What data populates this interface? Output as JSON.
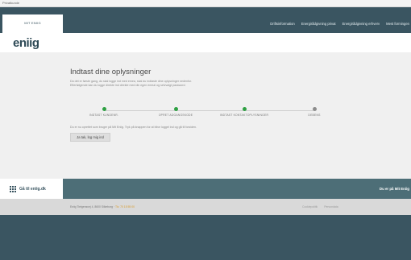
{
  "browser": {
    "tab_title": "Privatkunde"
  },
  "header": {
    "active_tab": "MIT ENIIG",
    "nav": [
      "Driftsinformation",
      "Energirådgivning privat",
      "Energirådgivning erhverv",
      "Mest formingen"
    ]
  },
  "brand": {
    "logo": "eniig"
  },
  "main": {
    "title": "Indtast dine oplysninger",
    "intro_lines": [
      "Da det er første gang, du skal logge ind med emea, skal du indtaste dine oplysninger nedenfor.",
      "Efterfølgende kan du logge direkte ind direkte med din egen emeal og selvvalgt password."
    ],
    "steps": [
      {
        "label": "INDTAST KUNDENR.",
        "status": "done"
      },
      {
        "label": "OPRET ADGANGSKODE",
        "status": "done"
      },
      {
        "label": "INDTAST KONTAKTOPLYSNINGER",
        "status": "done"
      },
      {
        "label": "DEBENS",
        "status": "pending"
      }
    ],
    "notice": "Du er nu oprettet som bruger på Mit Eniig. Tryk på knappen for at blive logget ind og gå til forsiden.",
    "login_button": "Ja tak, log mig ind"
  },
  "bar": {
    "left_link": "Gå til eniig.dk",
    "right_text": "Du er på Mit Eniig"
  },
  "footer": {
    "address": "Eniig Tietgensvej 4, 8600 Silkeborg ·",
    "address_link": "Tlv. 70 15 55 00",
    "links": [
      "Cookiepolitik",
      "Persondata"
    ]
  },
  "colors": {
    "primary": "#3a5561",
    "done": "#2ea043",
    "pending": "#8c8c8c",
    "bar": "#4d6e77"
  }
}
